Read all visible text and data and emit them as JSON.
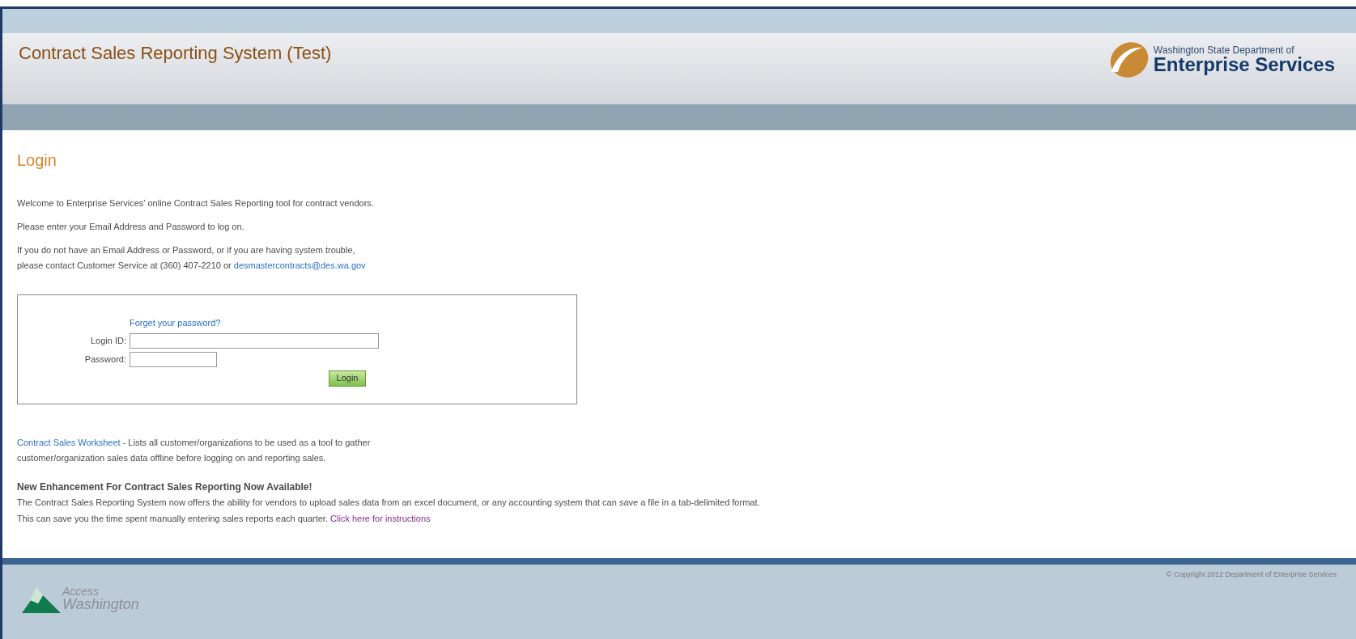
{
  "header": {
    "title": "Contract Sales Reporting System (Test)",
    "logo": {
      "line1": "Washington State Department of",
      "line2": "Enterprise Services"
    }
  },
  "login": {
    "heading": "Login",
    "paragraphs": [
      "Welcome to Enterprise Services' online Contract Sales Reporting tool for contract vendors.",
      "Please enter your Email Address and Password to log on."
    ],
    "contact": {
      "line1": "If you do not have an Email Address or Password, or if you are having system trouble,",
      "line2": "please contact Customer Service at (360) 407-2210 or",
      "email": "desmastercontracts@des.wa.gov"
    }
  },
  "form": {
    "forgot_link": "Forget your password?",
    "fields": [
      {
        "label": "Login ID:",
        "kind": "text"
      },
      {
        "label": "Password:",
        "kind": "password"
      }
    ],
    "button": "Login"
  },
  "worksheet": {
    "link": "Contract Sales Worksheet",
    "line1": " - Lists all customer/organizations to be used as a tool to gather",
    "line2": "customer/organization sales data offline before logging on and reporting sales."
  },
  "news": {
    "heading": "New Enhancement For Contract Sales Reporting Now Available!",
    "line1": "The Contract Sales Reporting System now offers the ability for vendors to upload sales data from an excel document, or any accounting system that can save a file in a tab-delimited format.",
    "line2": "This can save you the time spent manually entering sales reports each quarter.",
    "link": "Click here for instructions"
  },
  "footer": {
    "logo_line1": "Access",
    "logo_line2": "Washington",
    "copyright": "© Copyright 2012 Department of Enterprise Services"
  }
}
